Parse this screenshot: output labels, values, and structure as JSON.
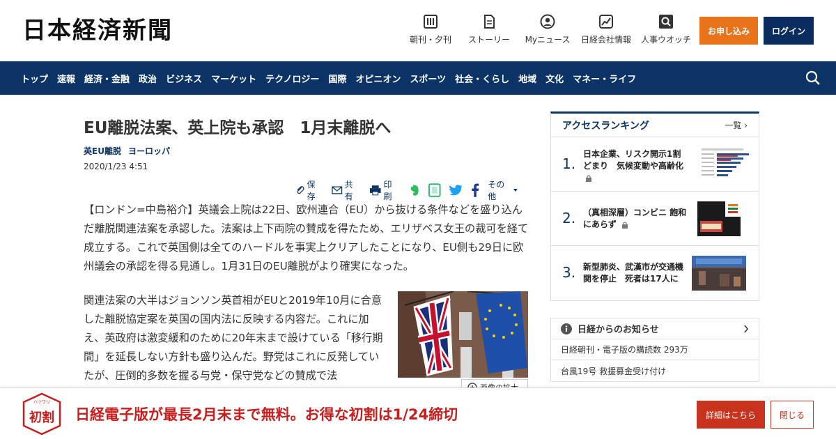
{
  "header": {
    "logo_text": "日本経済新聞",
    "nav": [
      {
        "label": "朝刊・夕刊",
        "icon": "newspaper-icon"
      },
      {
        "label": "ストーリー",
        "icon": "document-icon"
      },
      {
        "label": "Myニュース",
        "icon": "user-icon"
      },
      {
        "label": "日経会社情報",
        "icon": "chart-icon"
      },
      {
        "label": "人事ウオッチ",
        "icon": "search-person-icon"
      }
    ],
    "apply_label": "お申し込み",
    "login_label": "ログイン"
  },
  "navbar": {
    "items": [
      "トップ",
      "速報",
      "経済・金融",
      "政治",
      "ビジネス",
      "マーケット",
      "テクノロジー",
      "国際",
      "オピニオン",
      "スポーツ",
      "社会・くらし",
      "地域",
      "文化",
      "マネー・ライフ"
    ],
    "search_icon": "search-icon"
  },
  "article": {
    "title": "EU離脱法案、英上院も承認　1月末離脱へ",
    "tags": [
      "英EU離脱",
      "ヨーロッパ"
    ],
    "date": "2020/1/23 4:51",
    "actions": {
      "save": "保存",
      "share": "共有",
      "print": "印刷",
      "more": "その他"
    },
    "lead": "【ロンドン=中島裕介】英議会上院は22日、欧州連合（EU）から抜ける条件などを盛り込んだ離脱関連法案を承認した。法案は上下両院の賛成を得たため、エリザベス女王の裁可を経て成立する。これで英国側は全てのハードルを事実上クリアしたことになり、EU側も29日に欧州議会の承認を得る見通し。1月31日のEU離脱がより確実になった。",
    "body": "関連法案の大半はジョンソン英首相がEUと2019年10月に合意した離脱協定案を英国の国内法に反映する内容だ。これに加え、英政府は激変緩和のために20年末まで設けている「移行期間」を延長しない方針も盛り込んだ。野党はこれに反発していたが、圧倒的多数を握る与党・保守党などの賛成で法",
    "zoom_label": "画像の拡大"
  },
  "ranking": {
    "title": "アクセスランキング",
    "more": "一覧",
    "items": [
      {
        "rank": "1.",
        "text": "日本企業、リスク開示1割どまり　気候変動や高齢化"
      },
      {
        "rank": "2.",
        "text": "（真相深層）コンビニ 飽和にあらず"
      },
      {
        "rank": "3.",
        "text": "新型肺炎、武漢市が交通機関を停止　死者は17人に"
      }
    ]
  },
  "notice": {
    "title": "日経からのお知らせ",
    "rows": [
      "日経朝刊・電子版の購読数 293万",
      "台風19号 救援募金受け付け"
    ]
  },
  "banner": {
    "badge_text": "初割",
    "badge_ruby": "ハツワリ",
    "promo": "日経電子版が最長2月末まで無料。お得な初割は1/24締切",
    "detail_label": "詳細はこちら",
    "close_label": "閉じる"
  },
  "colors": {
    "navy": "#0b3366",
    "orange": "#e8731a",
    "promo_red": "#c81e1e"
  }
}
